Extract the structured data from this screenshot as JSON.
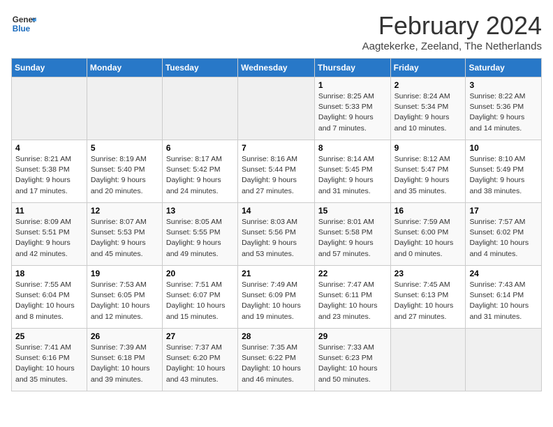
{
  "logo": {
    "line1": "General",
    "line2": "Blue"
  },
  "title": "February 2024",
  "subtitle": "Aagtekerke, Zeeland, The Netherlands",
  "days_of_week": [
    "Sunday",
    "Monday",
    "Tuesday",
    "Wednesday",
    "Thursday",
    "Friday",
    "Saturday"
  ],
  "weeks": [
    [
      {
        "day": "",
        "info": ""
      },
      {
        "day": "",
        "info": ""
      },
      {
        "day": "",
        "info": ""
      },
      {
        "day": "",
        "info": ""
      },
      {
        "day": "1",
        "info": "Sunrise: 8:25 AM\nSunset: 5:33 PM\nDaylight: 9 hours and 7 minutes."
      },
      {
        "day": "2",
        "info": "Sunrise: 8:24 AM\nSunset: 5:34 PM\nDaylight: 9 hours and 10 minutes."
      },
      {
        "day": "3",
        "info": "Sunrise: 8:22 AM\nSunset: 5:36 PM\nDaylight: 9 hours and 14 minutes."
      }
    ],
    [
      {
        "day": "4",
        "info": "Sunrise: 8:21 AM\nSunset: 5:38 PM\nDaylight: 9 hours and 17 minutes."
      },
      {
        "day": "5",
        "info": "Sunrise: 8:19 AM\nSunset: 5:40 PM\nDaylight: 9 hours and 20 minutes."
      },
      {
        "day": "6",
        "info": "Sunrise: 8:17 AM\nSunset: 5:42 PM\nDaylight: 9 hours and 24 minutes."
      },
      {
        "day": "7",
        "info": "Sunrise: 8:16 AM\nSunset: 5:44 PM\nDaylight: 9 hours and 27 minutes."
      },
      {
        "day": "8",
        "info": "Sunrise: 8:14 AM\nSunset: 5:45 PM\nDaylight: 9 hours and 31 minutes."
      },
      {
        "day": "9",
        "info": "Sunrise: 8:12 AM\nSunset: 5:47 PM\nDaylight: 9 hours and 35 minutes."
      },
      {
        "day": "10",
        "info": "Sunrise: 8:10 AM\nSunset: 5:49 PM\nDaylight: 9 hours and 38 minutes."
      }
    ],
    [
      {
        "day": "11",
        "info": "Sunrise: 8:09 AM\nSunset: 5:51 PM\nDaylight: 9 hours and 42 minutes."
      },
      {
        "day": "12",
        "info": "Sunrise: 8:07 AM\nSunset: 5:53 PM\nDaylight: 9 hours and 45 minutes."
      },
      {
        "day": "13",
        "info": "Sunrise: 8:05 AM\nSunset: 5:55 PM\nDaylight: 9 hours and 49 minutes."
      },
      {
        "day": "14",
        "info": "Sunrise: 8:03 AM\nSunset: 5:56 PM\nDaylight: 9 hours and 53 minutes."
      },
      {
        "day": "15",
        "info": "Sunrise: 8:01 AM\nSunset: 5:58 PM\nDaylight: 9 hours and 57 minutes."
      },
      {
        "day": "16",
        "info": "Sunrise: 7:59 AM\nSunset: 6:00 PM\nDaylight: 10 hours and 0 minutes."
      },
      {
        "day": "17",
        "info": "Sunrise: 7:57 AM\nSunset: 6:02 PM\nDaylight: 10 hours and 4 minutes."
      }
    ],
    [
      {
        "day": "18",
        "info": "Sunrise: 7:55 AM\nSunset: 6:04 PM\nDaylight: 10 hours and 8 minutes."
      },
      {
        "day": "19",
        "info": "Sunrise: 7:53 AM\nSunset: 6:05 PM\nDaylight: 10 hours and 12 minutes."
      },
      {
        "day": "20",
        "info": "Sunrise: 7:51 AM\nSunset: 6:07 PM\nDaylight: 10 hours and 15 minutes."
      },
      {
        "day": "21",
        "info": "Sunrise: 7:49 AM\nSunset: 6:09 PM\nDaylight: 10 hours and 19 minutes."
      },
      {
        "day": "22",
        "info": "Sunrise: 7:47 AM\nSunset: 6:11 PM\nDaylight: 10 hours and 23 minutes."
      },
      {
        "day": "23",
        "info": "Sunrise: 7:45 AM\nSunset: 6:13 PM\nDaylight: 10 hours and 27 minutes."
      },
      {
        "day": "24",
        "info": "Sunrise: 7:43 AM\nSunset: 6:14 PM\nDaylight: 10 hours and 31 minutes."
      }
    ],
    [
      {
        "day": "25",
        "info": "Sunrise: 7:41 AM\nSunset: 6:16 PM\nDaylight: 10 hours and 35 minutes."
      },
      {
        "day": "26",
        "info": "Sunrise: 7:39 AM\nSunset: 6:18 PM\nDaylight: 10 hours and 39 minutes."
      },
      {
        "day": "27",
        "info": "Sunrise: 7:37 AM\nSunset: 6:20 PM\nDaylight: 10 hours and 43 minutes."
      },
      {
        "day": "28",
        "info": "Sunrise: 7:35 AM\nSunset: 6:22 PM\nDaylight: 10 hours and 46 minutes."
      },
      {
        "day": "29",
        "info": "Sunrise: 7:33 AM\nSunset: 6:23 PM\nDaylight: 10 hours and 50 minutes."
      },
      {
        "day": "",
        "info": ""
      },
      {
        "day": "",
        "info": ""
      }
    ]
  ]
}
